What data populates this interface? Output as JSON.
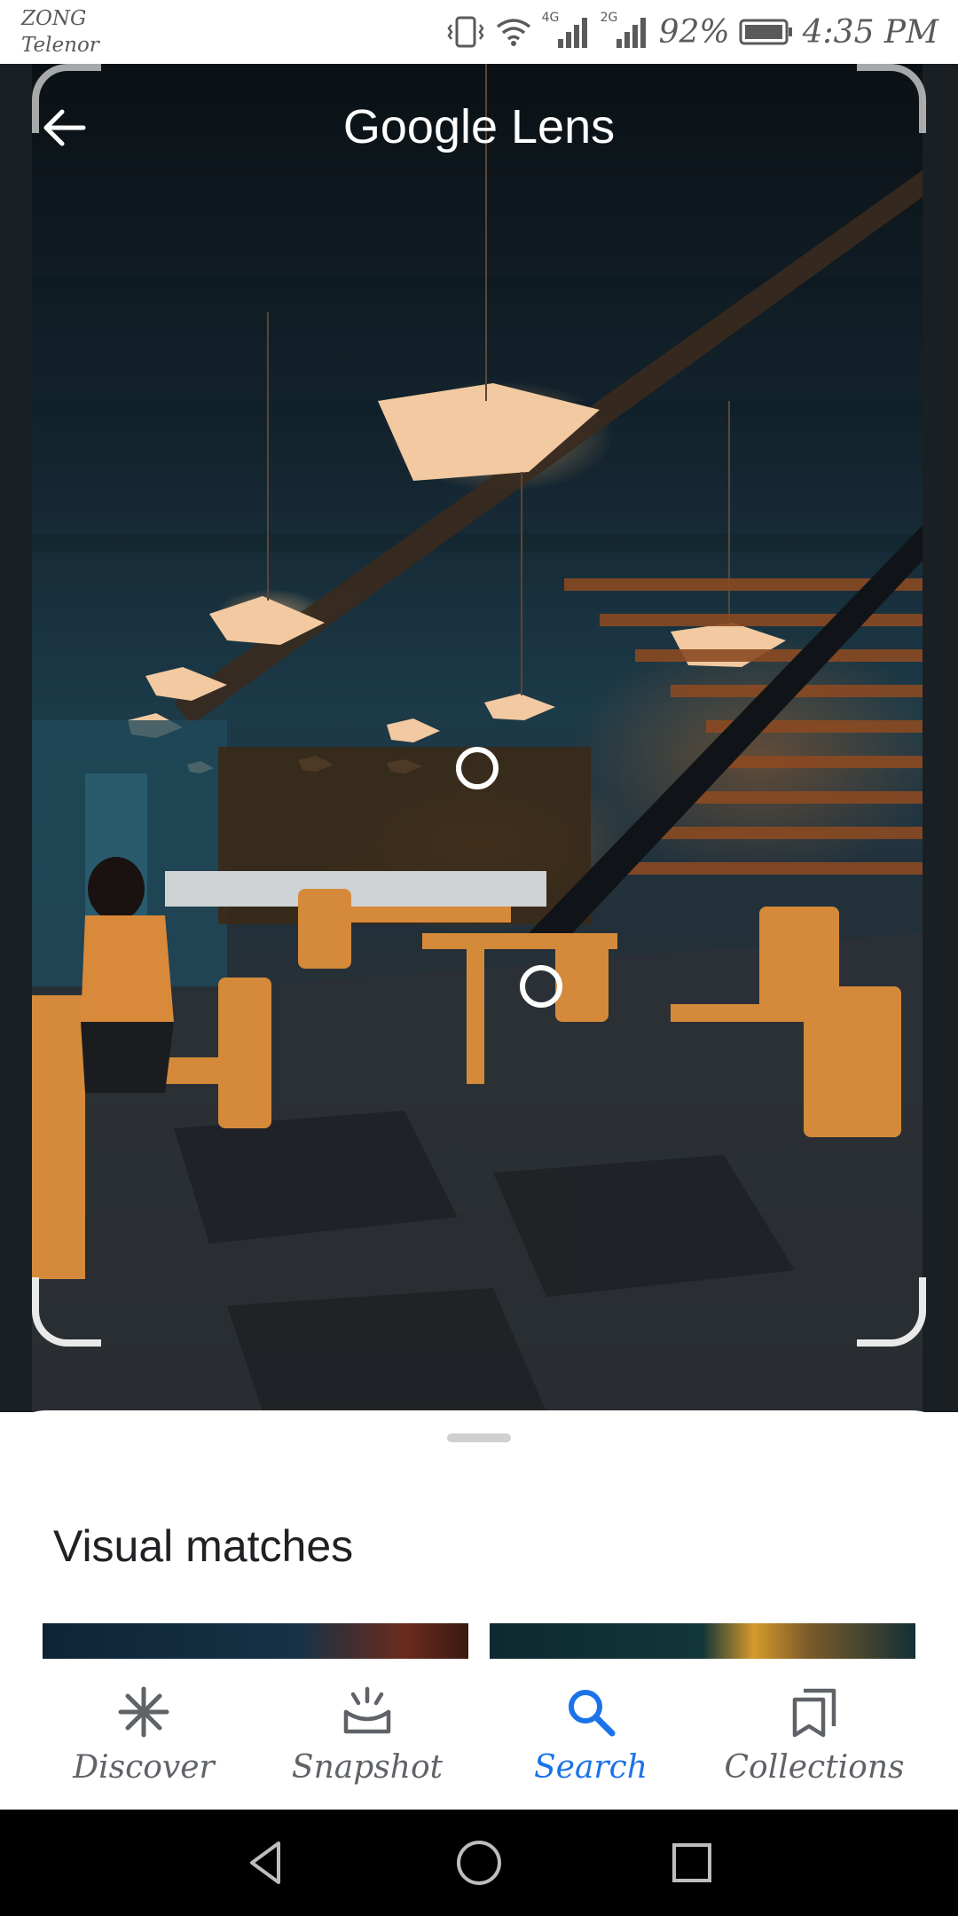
{
  "status_bar": {
    "carrier_1": "ZONG",
    "carrier_2": "Telenor",
    "network_1": "4G",
    "network_2": "2G",
    "battery": "92%",
    "time": "4:35 PM"
  },
  "header": {
    "title": "Google Lens"
  },
  "sheet": {
    "title": "Visual matches"
  },
  "bottom_nav": {
    "items": [
      {
        "label": "Discover",
        "icon": "discover-icon"
      },
      {
        "label": "Snapshot",
        "icon": "snapshot-icon"
      },
      {
        "label": "Search",
        "icon": "search-icon",
        "active": true
      },
      {
        "label": "Collections",
        "icon": "collections-icon"
      }
    ]
  },
  "colors": {
    "accent": "#1a73e8",
    "nav_inactive": "#5f6368"
  }
}
